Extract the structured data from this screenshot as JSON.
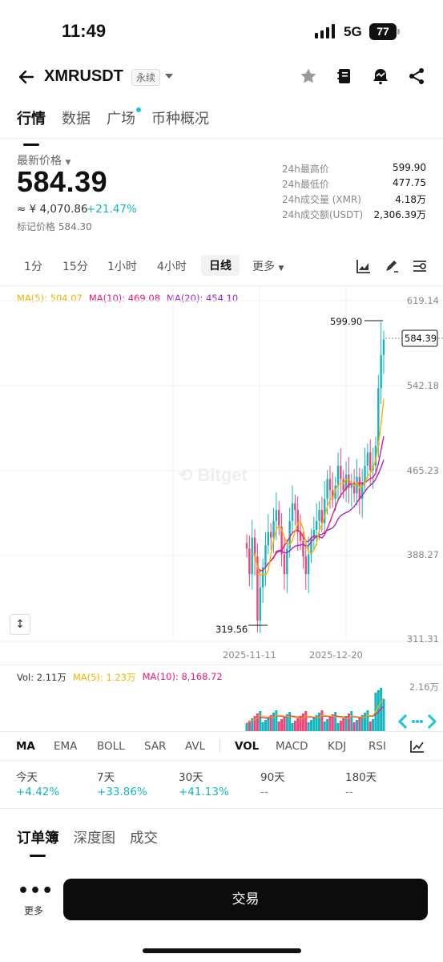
{
  "status_bar": {
    "time": "11:49",
    "network": "5G",
    "battery": "77"
  },
  "header": {
    "pair": "XMRUSDT",
    "badge": "永续"
  },
  "main_tabs": [
    "行情",
    "数据",
    "广场",
    "币种概况"
  ],
  "price": {
    "label": "最新价格",
    "last": "584.39",
    "cny": "≈ ¥ 4,070.86",
    "change": "+21.47%",
    "mark": "标记价格 584.30"
  },
  "stats": [
    {
      "key": "24h最高价",
      "value": "599.90"
    },
    {
      "key": "24h最低价",
      "value": "477.75"
    },
    {
      "key": "24h成交量 (XMR)",
      "value": "4.18万"
    },
    {
      "key": "24h成交额(USDT)",
      "value": "2,306.39万"
    }
  ],
  "intervals": [
    "1分",
    "15分",
    "1小时",
    "4小时",
    "日线",
    "更多"
  ],
  "chart": {
    "ma5_label": "MA(5): 504.07",
    "ma10_label": "MA(10): 469.08",
    "ma20_label": "MA(20): 454.10",
    "y_ticks": [
      "619.14",
      "542.18",
      "465.23",
      "388.27",
      "311.31"
    ],
    "high_marker": "599.90",
    "low_marker": "319.56",
    "current_price": "584.39",
    "dates": [
      "2025-11-11",
      "2025-12-20"
    ],
    "watermark": "Bitget",
    "vol_label": "Vol: 2.11万",
    "vol_ma5_label": "MA(5): 1.23万",
    "vol_ma10_label": "MA(10): 8,168.72",
    "vol_top": "2.16万"
  },
  "chart_data": {
    "type": "candlestick",
    "interval": "1D",
    "ylim": [
      311.31,
      619.14
    ],
    "dates": [
      "2025-11-11",
      "2025-12-20"
    ],
    "high": 599.9,
    "low": 319.56,
    "last": 584.39
  },
  "colors": {
    "up": "#13b6bf",
    "down": "#f0447a",
    "ma5": "#f4b400",
    "ma10": "#e6197b",
    "ma20": "#9c27d8"
  },
  "indicator_tabs": [
    "MA",
    "EMA",
    "BOLL",
    "SAR",
    "AVL",
    "VOL",
    "MACD",
    "KDJ",
    "RSI"
  ],
  "performance": [
    {
      "key": "今天",
      "value": "+4.42%"
    },
    {
      "key": "7天",
      "value": "+33.86%"
    },
    {
      "key": "30天",
      "value": "+41.13%"
    },
    {
      "key": "90天",
      "value": "--"
    },
    {
      "key": "180天",
      "value": "--"
    }
  ],
  "book_tabs": [
    "订单簿",
    "深度图",
    "成交"
  ],
  "footer": {
    "more": "更多",
    "trade": "交易"
  }
}
